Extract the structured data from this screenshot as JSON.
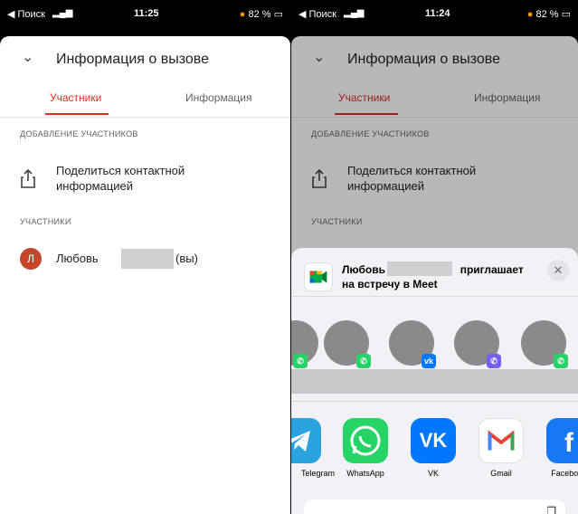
{
  "left": {
    "status": {
      "back": "◀ Поиск",
      "time": "11:25",
      "battery": "82 %"
    },
    "header": {
      "title": "Информация о вызове"
    },
    "tabs": [
      {
        "label": "Участники"
      },
      {
        "label": "Информация"
      }
    ],
    "add_section": "ДОБАВЛЕНИЕ УЧАСТНИКОВ",
    "share_label": "Поделиться контактной информацией",
    "participants_section": "УЧАСТНИКИ",
    "participant": {
      "initial": "Л",
      "name": "Любовь",
      "suffix": "(вы)"
    }
  },
  "right": {
    "status": {
      "back": "◀ Поиск",
      "time": "11:24",
      "battery": "82 %"
    },
    "header": {
      "title": "Информация о вызове"
    },
    "tabs": [
      {
        "label": "Участники"
      },
      {
        "label": "Информация"
      }
    ],
    "add_section": "ДОБАВЛЕНИЕ УЧАСТНИКОВ",
    "share_label": "Поделиться контактной информацией",
    "participants_section": "УЧАСТНИКИ",
    "share_sheet": {
      "title_name": "Любовь",
      "title_rest": "приглашает на встречу в Meet",
      "close": "✕",
      "apps": [
        {
          "label": "Telegram",
          "icon": "telegram-icon",
          "color": "#2aa3e0"
        },
        {
          "label": "WhatsApp",
          "icon": "whatsapp-icon",
          "color": "#25d366"
        },
        {
          "label": "VK",
          "icon": "vk-icon",
          "color": "#0077ff"
        },
        {
          "label": "Gmail",
          "icon": "gmail-icon",
          "color": "#ffffff"
        },
        {
          "label": "Facebook",
          "icon": "facebook-icon",
          "color": "#1877f2"
        }
      ]
    }
  },
  "colors": {
    "accent": "#d93025",
    "avatar": "#c5462b"
  }
}
